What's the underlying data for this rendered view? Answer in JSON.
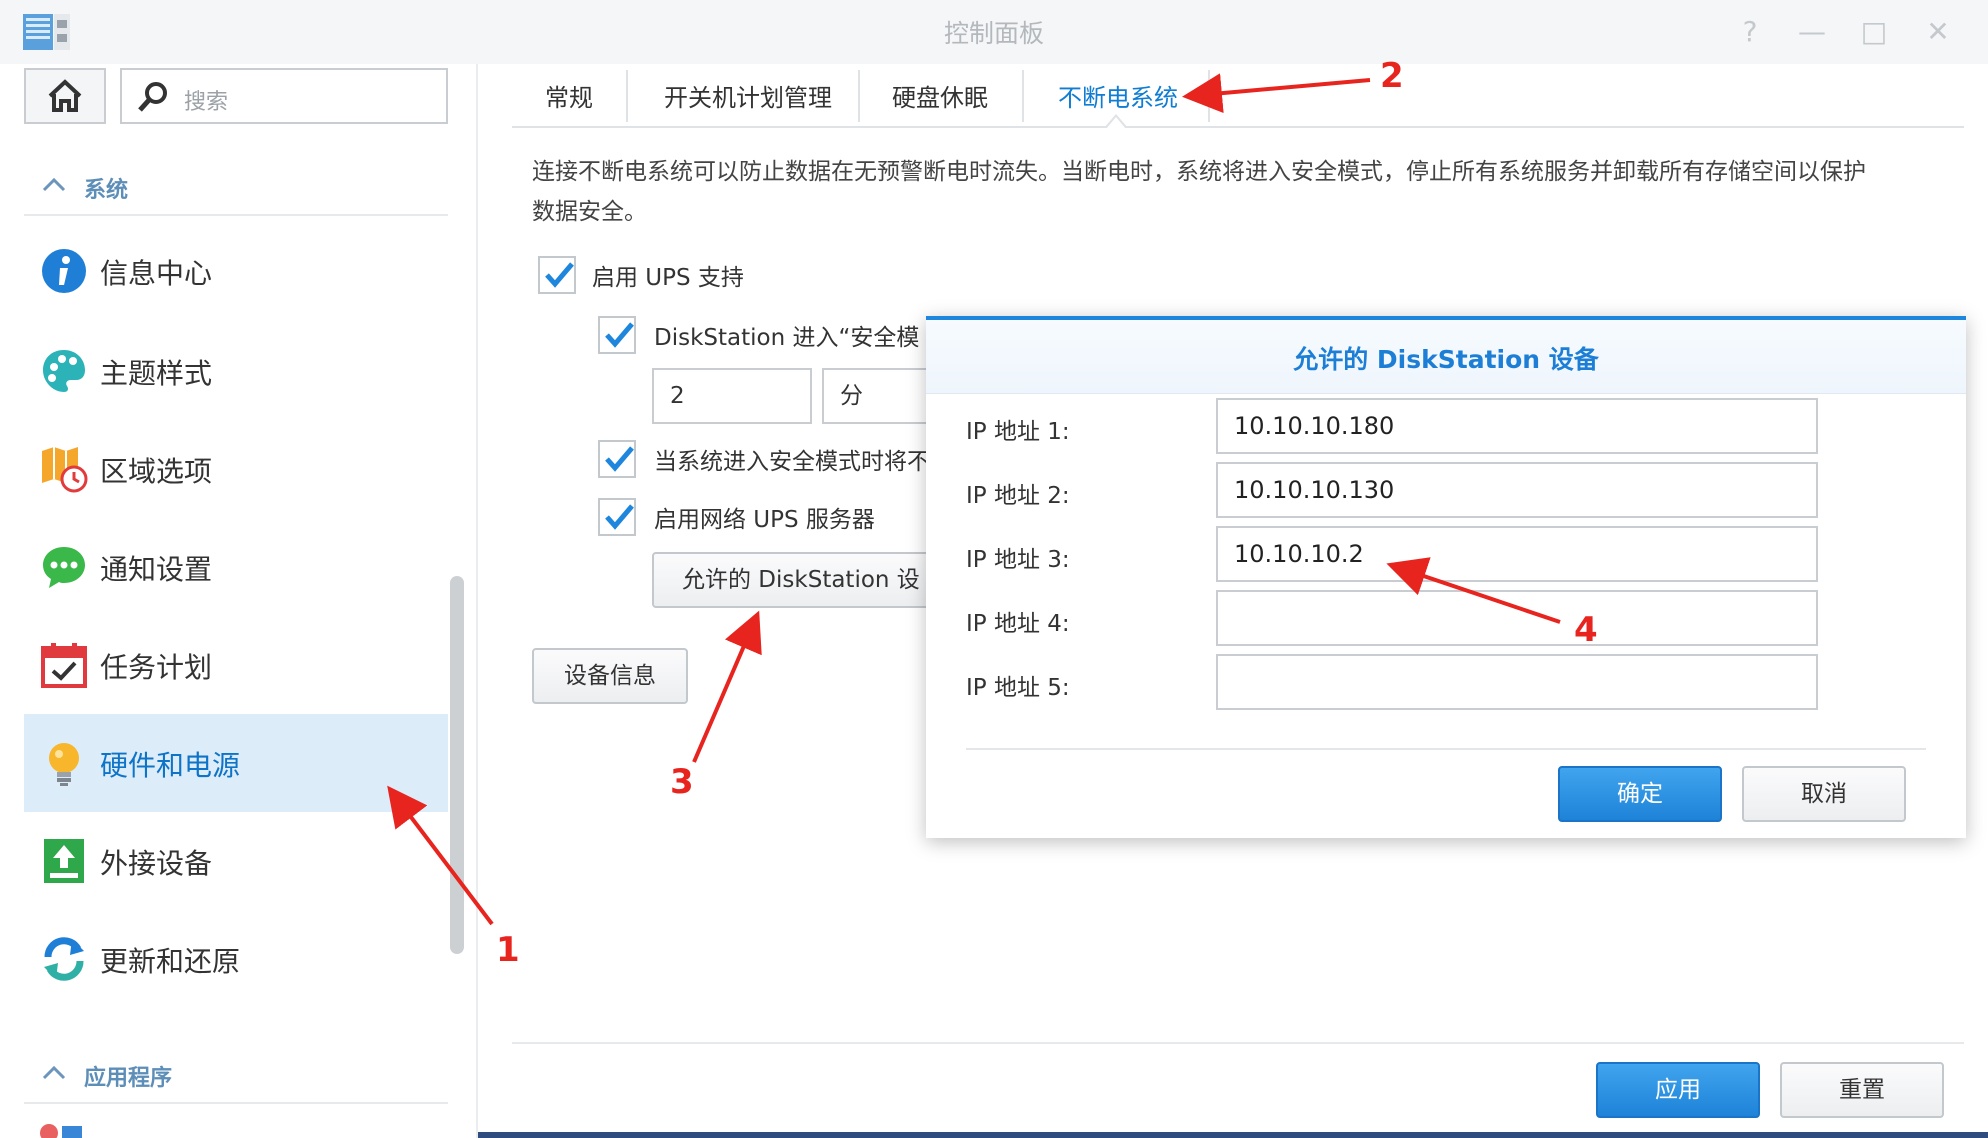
{
  "window": {
    "title": "控制面板",
    "help_label": "?",
    "minimize_label": "—",
    "maximize_label": "□",
    "close_label": "✕"
  },
  "sidebar": {
    "search_placeholder": "搜索",
    "section_system": "系统",
    "section_apps": "应用程序",
    "items": [
      {
        "label": "信息中心",
        "icon": "info-icon"
      },
      {
        "label": "主题样式",
        "icon": "palette-icon"
      },
      {
        "label": "区域选项",
        "icon": "map-clock-icon"
      },
      {
        "label": "通知设置",
        "icon": "chat-bubble-icon"
      },
      {
        "label": "任务计划",
        "icon": "calendar-check-icon"
      },
      {
        "label": "硬件和电源",
        "icon": "light-bulb-icon",
        "active": true
      },
      {
        "label": "外接设备",
        "icon": "upload-icon"
      },
      {
        "label": "更新和还原",
        "icon": "refresh-icon"
      }
    ]
  },
  "tabs": [
    {
      "label": "常规"
    },
    {
      "label": "开关机计划管理"
    },
    {
      "label": "硬盘休眠"
    },
    {
      "label": "不断电系统",
      "active": true
    }
  ],
  "main": {
    "description_line1": "连接不断电系统可以防止数据在无预警断电时流失。当断电时，系统将进入安全模式，停止所有系统服务并卸载所有存储空间以保护",
    "description_line2": "数据安全。",
    "enable_ups_label": "启用 UPS 支持",
    "safe_mode_label": "DiskStation 进入“安全模",
    "time_value": "2",
    "time_unit": "分",
    "shutdown_label": "当系统进入安全模式时将不",
    "network_ups_label": "启用网络 UPS 服务器",
    "allowed_button": "允许的 DiskStation 设",
    "device_info_button": "设备信息",
    "apply_button": "应用",
    "reset_button": "重置"
  },
  "dialog": {
    "title": "允许的 DiskStation 设备",
    "ip_fields": [
      {
        "label": "IP 地址 1:",
        "value": "10.10.10.180"
      },
      {
        "label": "IP 地址 2:",
        "value": "10.10.10.130"
      },
      {
        "label": "IP 地址 3:",
        "value": "10.10.10.2"
      },
      {
        "label": "IP 地址 4:",
        "value": ""
      },
      {
        "label": "IP 地址 5:",
        "value": ""
      }
    ],
    "ok_button": "确定",
    "cancel_button": "取消"
  },
  "annotations": {
    "n1": "1",
    "n2": "2",
    "n3": "3",
    "n4": "4",
    "color": "#e8241f"
  },
  "colors": {
    "accent": "#1e86dc",
    "active_bg": "#dcecf9",
    "section_text": "#5d8eb8"
  }
}
